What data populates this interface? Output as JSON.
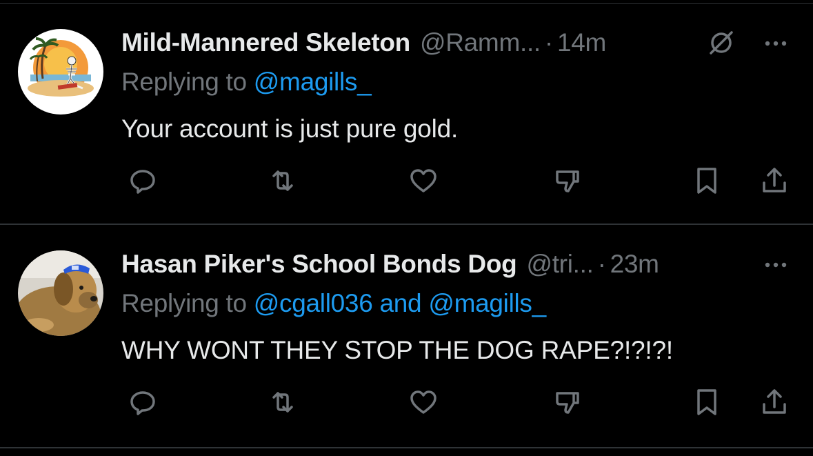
{
  "theme": {
    "background": "#000000",
    "primary_text": "#e7e9ea",
    "secondary_text": "#71767b",
    "link": "#1d9bf0",
    "divider": "#2f3336"
  },
  "replies": [
    {
      "display_name": "Mild-Mannered Skeleton",
      "handle": "@Ramm...",
      "separator": "·",
      "time": "14m",
      "replying_prefix": "Replying to",
      "mention_1": "@magills_",
      "text": "Your account is just pure gold.",
      "avatar": "skeleton-on-beach-avatar",
      "has_grok_icon": true,
      "actions": [
        "reply-icon",
        "retweet-icon",
        "like-icon",
        "dislike-icon",
        "bookmark-icon",
        "share-icon"
      ]
    },
    {
      "display_name": "Hasan Piker's School Bonds Dog",
      "handle": "@tri...",
      "separator": "·",
      "time": "23m",
      "replying_prefix": "Replying to",
      "mention_1": "@cgall036",
      "conjunction": "and",
      "mention_2": "@magills_",
      "text": "WHY WONT THEY STOP THE DOG RAPE?!?!?!",
      "avatar": "dog-with-cap-avatar",
      "has_grok_icon": false,
      "actions": [
        "reply-icon",
        "retweet-icon",
        "like-icon",
        "dislike-icon",
        "bookmark-icon",
        "share-icon"
      ]
    }
  ]
}
